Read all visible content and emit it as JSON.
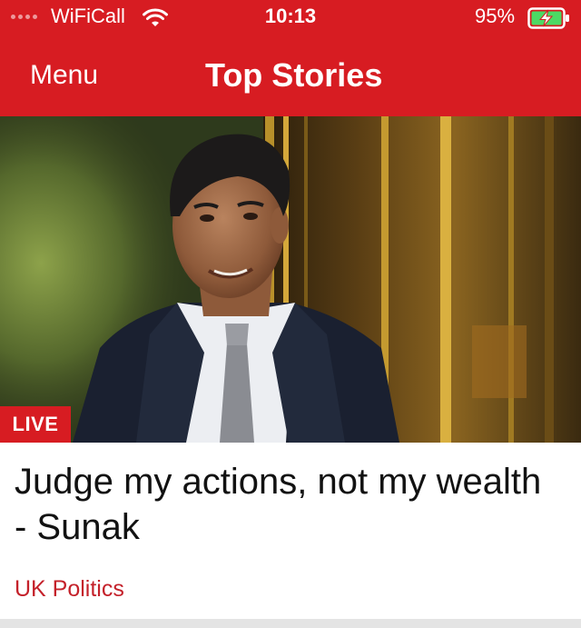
{
  "status_bar": {
    "carrier": "WiFiCall",
    "time": "10:13",
    "battery_percent": "95%",
    "wifi_icon": "wifi-icon",
    "battery_icon": "battery-charging-icon"
  },
  "nav": {
    "menu_label": "Menu",
    "title": "Top Stories"
  },
  "story": {
    "image_icon": "news-photo",
    "badge": "LIVE",
    "headline": "Judge my actions, not my wealth - Sunak",
    "category": "UK Politics"
  },
  "colors": {
    "brand_red": "#d71c22",
    "category_red": "#c4212a",
    "headline_text": "#121212"
  }
}
